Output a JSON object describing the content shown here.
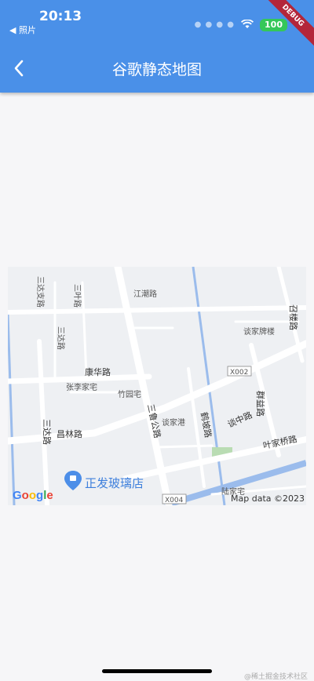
{
  "status_bar": {
    "time": "20:13",
    "back_app": "◀ 照片",
    "battery": "100",
    "debug": "DEBUG"
  },
  "app_bar": {
    "title": "谷歌静态地图"
  },
  "map": {
    "labels": {
      "sanda_zhi_lu": "三达支路",
      "sanye_lu": "三叶路",
      "jiangchao_lu": "江潮路",
      "sanda_lu_top": "三达路",
      "tanjia_pailou": "谈家牌楼",
      "zhaolou_lu": "召楼路",
      "kanghua_lu": "康华路",
      "x002": "X002",
      "zhanglijia_zhai": "张李家宅",
      "zhuyuan_zhai": "竹园宅",
      "qunyi_lu": "群益路",
      "sanda_lu": "三达路",
      "sanlu_gonglu": "三鲁公路",
      "tanjia_gang": "谈家港",
      "hepo_lu": "鹤坡路",
      "tanzhong_lu": "谈中路",
      "changlin_lu": "昌林路",
      "yejiaqiao_lu": "叶家桥路",
      "shop": "正发玻璃店",
      "x004": "X004",
      "lujia_zhai": "陆家宅"
    },
    "attribution": "Map data ©2023",
    "google": "Google"
  },
  "watermark": "@稀土掘金技术社区"
}
